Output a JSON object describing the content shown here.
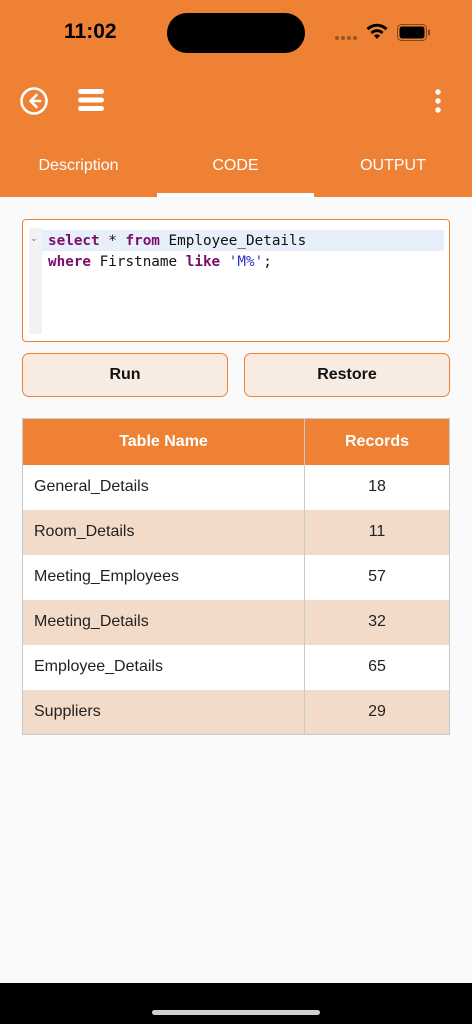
{
  "status_bar": {
    "time": "11:02"
  },
  "tabs": [
    {
      "label": "Description"
    },
    {
      "label": "CODE"
    },
    {
      "label": "OUTPUT"
    }
  ],
  "icons": {
    "back": "back-arrow-circle-icon",
    "menu": "hamburger-menu-icon",
    "more": "more-vertical-icon",
    "wifi": "wifi-icon",
    "battery": "battery-icon"
  },
  "colors": {
    "accent": "#ee8133",
    "row_alt": "#f2dbc9",
    "button_bg": "#f7ebe2",
    "keyword": "#7b0d6b",
    "string": "#2b32c9"
  },
  "editor": {
    "line1": {
      "kw1": "select",
      "mid1": " * ",
      "kw2": "from",
      "rest": " Employee_Details"
    },
    "line2": {
      "kw1": "where",
      "mid1": " Firstname ",
      "kw2": "like",
      "mid2": " ",
      "str": "'M%'",
      "end": ";"
    }
  },
  "buttons": {
    "run": "Run",
    "restore": "Restore"
  },
  "table": {
    "headers": {
      "name": "Table Name",
      "records": "Records"
    },
    "rows": [
      {
        "name": "General_Details",
        "records": "18"
      },
      {
        "name": "Room_Details",
        "records": "11"
      },
      {
        "name": "Meeting_Employees",
        "records": "57"
      },
      {
        "name": "Meeting_Details",
        "records": "32"
      },
      {
        "name": "Employee_Details",
        "records": "65"
      },
      {
        "name": "Suppliers",
        "records": "29"
      }
    ]
  }
}
